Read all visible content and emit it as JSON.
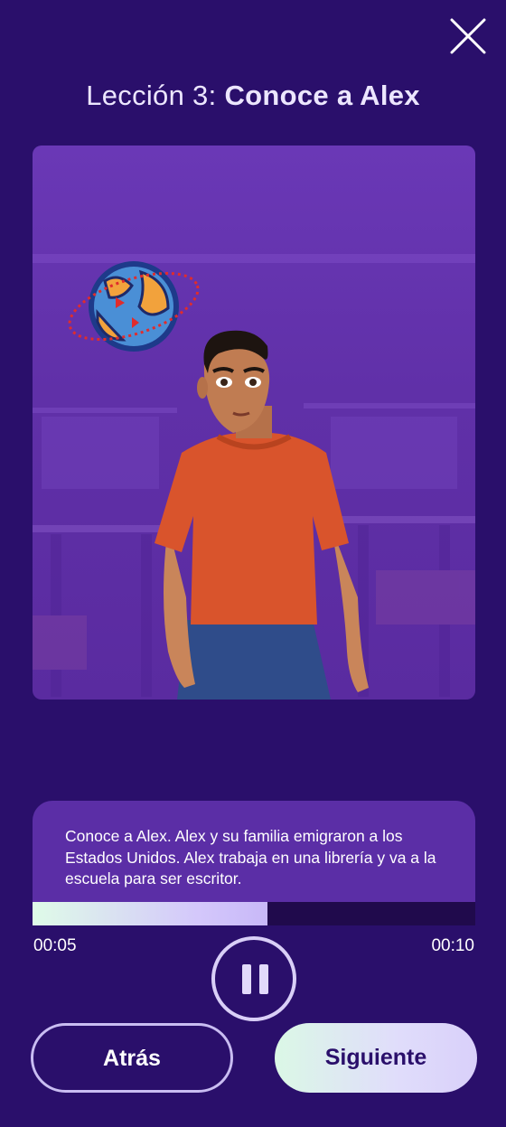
{
  "header": {
    "title_light": "Lección 3:",
    "title_bold": "Conoce a Alex",
    "close_icon": "close-icon"
  },
  "video": {
    "scene": "animated-character-alex-in-bookstore",
    "badge_icon": "globe-migration-icon"
  },
  "caption": {
    "text": "Conoce a Alex. Alex y su familia emigraron a los Estados Unidos. Alex trabaja en una librería y va a la escuela para ser escritor."
  },
  "player": {
    "current_time": "00:05",
    "total_time": "00:10",
    "progress": 0.53,
    "pause_icon": "pause-icon"
  },
  "buttons": {
    "back_label": "Atrás",
    "next_label": "Siguiente"
  },
  "colors": {
    "background": "#2a0f6b",
    "card": "#5b2ea6",
    "accent_gradient_start": "#dffbe8",
    "accent_gradient_end": "#d4c8fb"
  }
}
